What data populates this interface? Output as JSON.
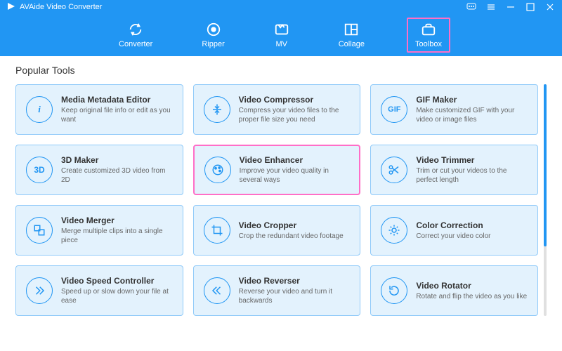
{
  "app_title": "AVAide Video Converter",
  "tabs": [
    {
      "label": "Converter"
    },
    {
      "label": "Ripper"
    },
    {
      "label": "MV"
    },
    {
      "label": "Collage"
    },
    {
      "label": "Toolbox"
    }
  ],
  "section_title": "Popular Tools",
  "tools": [
    {
      "title": "Media Metadata Editor",
      "desc": "Keep original file info or edit as you want",
      "icon": "i"
    },
    {
      "title": "Video Compressor",
      "desc": "Compress your video files to the proper file size you need",
      "icon": "compress"
    },
    {
      "title": "GIF Maker",
      "desc": "Make customized GIF with your video or image files",
      "icon": "GIF"
    },
    {
      "title": "3D Maker",
      "desc": "Create customized 3D video from 2D",
      "icon": "3D"
    },
    {
      "title": "Video Enhancer",
      "desc": "Improve your video quality in several ways",
      "icon": "palette"
    },
    {
      "title": "Video Trimmer",
      "desc": "Trim or cut your videos to the perfect length",
      "icon": "scissors"
    },
    {
      "title": "Video Merger",
      "desc": "Merge multiple clips into a single piece",
      "icon": "merge"
    },
    {
      "title": "Video Cropper",
      "desc": "Crop the redundant video footage",
      "icon": "crop"
    },
    {
      "title": "Color Correction",
      "desc": "Correct your video color",
      "icon": "sun"
    },
    {
      "title": "Video Speed Controller",
      "desc": "Speed up or slow down your file at ease",
      "icon": "speed"
    },
    {
      "title": "Video Reverser",
      "desc": "Reverse your video and turn it backwards",
      "icon": "reverse"
    },
    {
      "title": "Video Rotator",
      "desc": "Rotate and flip the video as you like",
      "icon": "rotate"
    }
  ]
}
